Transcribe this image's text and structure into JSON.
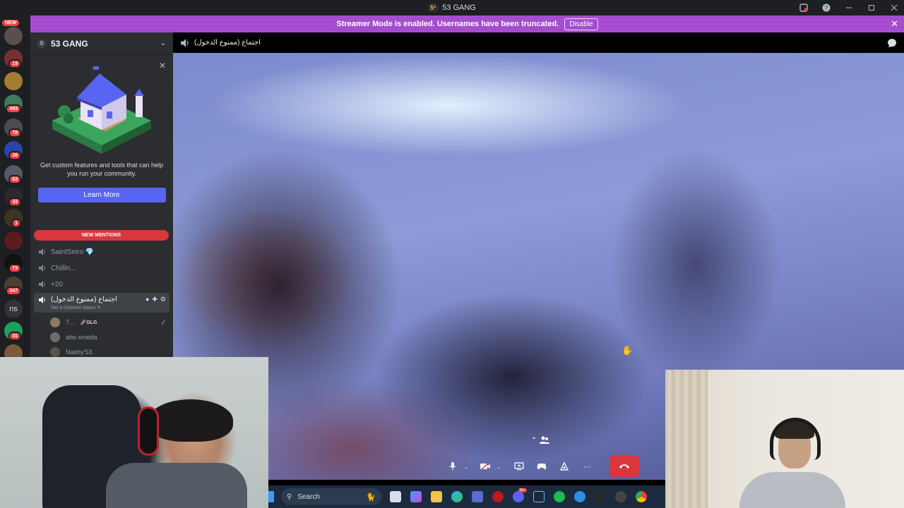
{
  "window": {
    "title": "53 GANG",
    "app_badge": "5³"
  },
  "banner": {
    "text": "Streamer Mode is enabled. Usernames have been truncated.",
    "button": "Disable"
  },
  "rail": {
    "new_label": "NEW",
    "ns_label": "ns",
    "badges": [
      {
        "count": "19"
      },
      {
        "count": "493"
      },
      {
        "count": "78"
      },
      {
        "count": "36"
      },
      {
        "count": "53"
      },
      {
        "count": "33"
      },
      {
        "count": "1"
      },
      {
        "count": "73"
      },
      {
        "count": "347"
      },
      {
        "count": "31"
      }
    ]
  },
  "server": {
    "boost_level": "0",
    "name": "53 GANG"
  },
  "promo": {
    "text": "Get custom features and tools that can help you run your community.",
    "button": "Learn More"
  },
  "mentions_label": "NEW MENTIONS",
  "channels": [
    {
      "name": "SaintSeiro 💎"
    },
    {
      "name": "Chillin..."
    },
    {
      "name": "+20"
    }
  ],
  "active_channel": {
    "name": "اجتماع (ممنوع الدخول)",
    "status_placeholder": "Set a channel status ✎"
  },
  "voice_members": [
    {
      "name": "7...",
      "tag": "🚀GLG"
    },
    {
      "name": "abo smeda",
      "tag": ""
    },
    {
      "name": "Nashy'53",
      "tag": ""
    }
  ],
  "voice_header": {
    "channel_name": "اجتماع (ممنوع الدخول)"
  },
  "taskbar": {
    "search_placeholder": "Search",
    "discord_badge": "99+"
  },
  "colors": {
    "banner": "#a64dcf",
    "blurple": "#5865f2",
    "danger": "#da373c",
    "sidebar": "#2b2d31",
    "rail": "#1e1f22"
  }
}
